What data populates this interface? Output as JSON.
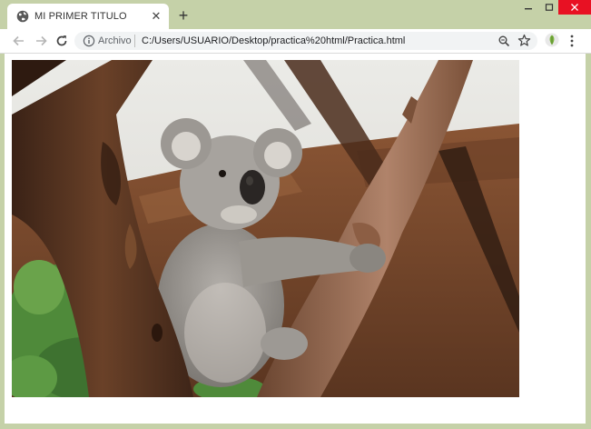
{
  "browser": {
    "tab": {
      "title": "MI PRIMER TITULO",
      "favicon": "globe-icon",
      "close_icon": "close-icon"
    },
    "new_tab_icon": "plus-icon",
    "window_controls": [
      "minimize-icon",
      "maximize-icon",
      "close-icon"
    ],
    "toolbar": {
      "back_icon": "arrow-left-icon",
      "forward_icon": "arrow-right-icon",
      "reload_icon": "reload-icon",
      "omnibox": {
        "info_icon": "info-icon",
        "scheme_label": "Archivo",
        "url": "C:/Users/USUARIO/Desktop/practica%20html/Practica.html",
        "zoom_icon": "zoom-icon",
        "bookmark_icon": "star-icon"
      },
      "extension_icon": "extension-icon",
      "menu_icon": "kebab-menu-icon"
    }
  },
  "page": {
    "image": {
      "subject": "koala",
      "colors": {
        "sky": "#e6e6e2",
        "roof": "#7a4a2c",
        "fur": "#a09c97",
        "bark": "#5b3a25",
        "leaves": "#4f8a3a"
      }
    }
  }
}
